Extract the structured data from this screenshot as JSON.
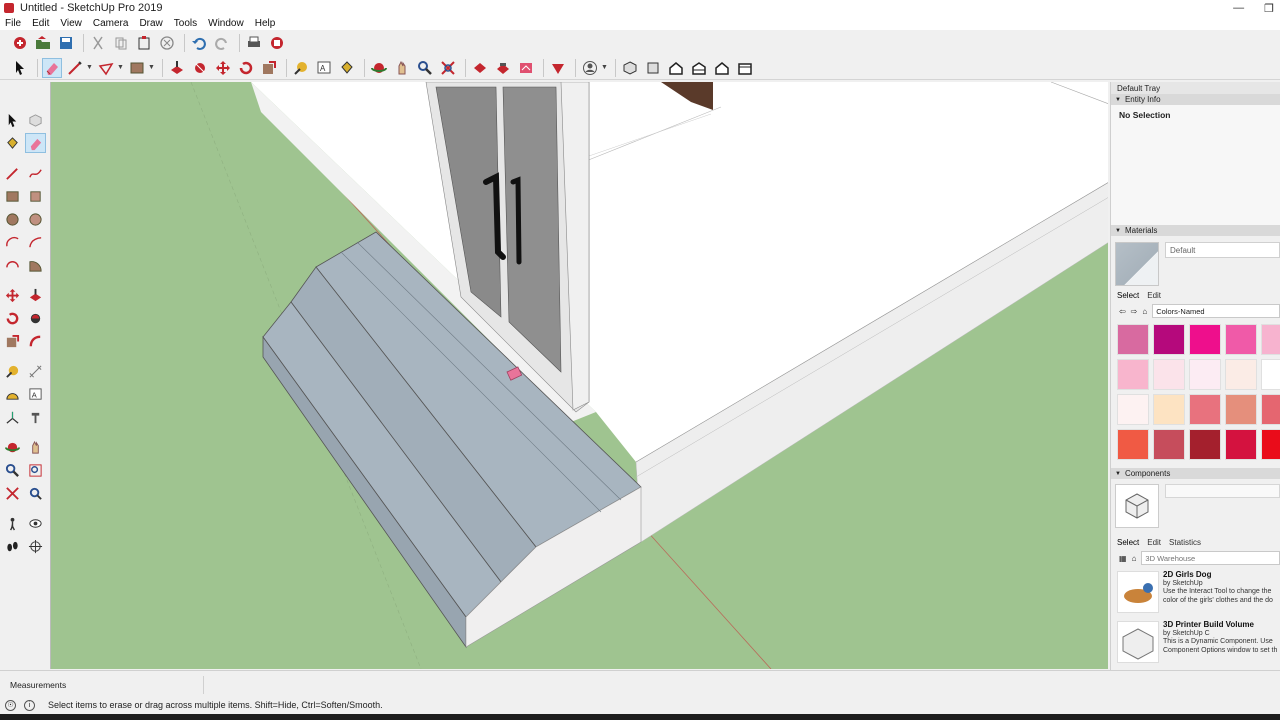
{
  "window": {
    "title": "Untitled - SketchUp Pro 2019"
  },
  "menu": [
    "File",
    "Edit",
    "View",
    "Camera",
    "Draw",
    "Tools",
    "Window",
    "Help"
  ],
  "tray": {
    "title": "Default Tray",
    "entity_info": {
      "header": "Entity Info",
      "text": "No Selection"
    },
    "materials": {
      "header": "Materials",
      "current": "Default",
      "tabs": [
        "Select",
        "Edit"
      ],
      "library": "Colors-Named",
      "swatches": [
        "#d86aa0",
        "#b5097c",
        "#ee0f8c",
        "#f05aa8",
        "#f7b3cf",
        "#f8b5cd",
        "#fbe3ea",
        "#fcecf3",
        "#fbece6",
        "#ffffff",
        "#fdf2f2",
        "#fde3c2",
        "#e8727e",
        "#e58f7c",
        "#e56670",
        "#f05a44",
        "#c64d5c",
        "#a4202d",
        "#d4123f",
        "#ea0c1a"
      ]
    },
    "components": {
      "header": "Components",
      "tabs": [
        "Select",
        "Edit",
        "Statistics"
      ],
      "search_placeholder": "3D Warehouse",
      "items": [
        {
          "name": "2D Girls Dog",
          "author": "by SketchUp",
          "desc1": "Use the Interact Tool to change the",
          "desc2": "color of the girls' clothes and the do"
        },
        {
          "name": "3D Printer Build Volume",
          "author": "by SketchUp C",
          "desc1": "This is a Dynamic Component. Use",
          "desc2": "Component Options window to set th"
        }
      ]
    }
  },
  "measurements": {
    "label": "Measurements"
  },
  "status": {
    "text": "Select items to erase or drag across multiple items. Shift=Hide, Ctrl=Soften/Smooth."
  },
  "colors": {
    "ground": "#9fc490",
    "steps": "#a8b5c0",
    "accent_red": "#c4262e"
  }
}
